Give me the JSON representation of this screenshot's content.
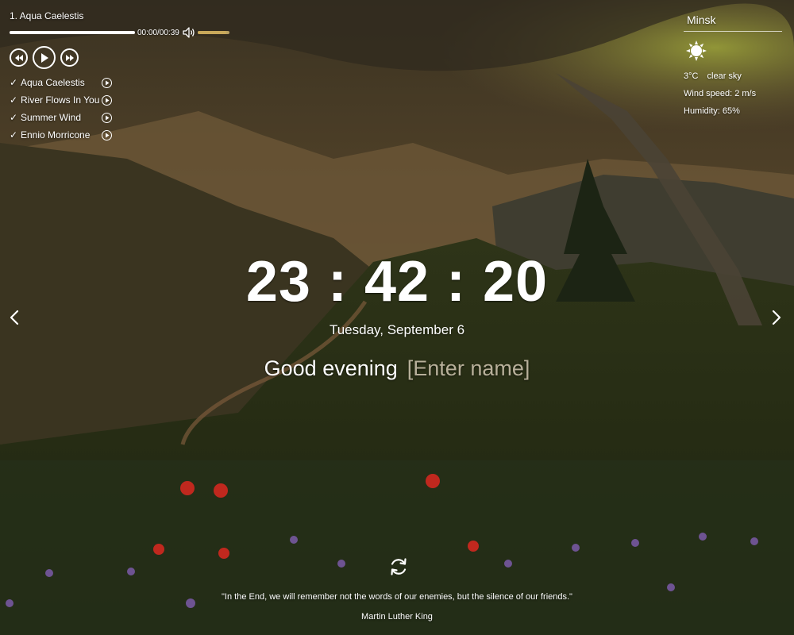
{
  "player": {
    "current_track": "1. Aqua Caelestis",
    "time": "00:00/00:39",
    "progress_fraction": 0,
    "volume_fraction": 0.9,
    "playlist": [
      {
        "label": "Aqua Caelestis",
        "check": "✓"
      },
      {
        "label": "River Flows In You",
        "check": "✓"
      },
      {
        "label": "Summer Wind",
        "check": "✓"
      },
      {
        "label": "Ennio Morricone",
        "check": "✓"
      }
    ],
    "icons": {
      "prev": "rewind-icon",
      "play": "play-icon",
      "next": "fast-forward-icon",
      "volume": "volume-icon"
    }
  },
  "weather": {
    "city": "Minsk",
    "icon": "clear-sky-sun-icon",
    "temperature": "3°C",
    "description": "clear sky",
    "wind": "Wind speed: 2 m/s",
    "humidity": "Humidity: 65%"
  },
  "clock": {
    "time": "23 : 42 : 20",
    "date": "Tuesday, September 6"
  },
  "greeting": {
    "text": "Good evening",
    "name_placeholder": "[Enter name]"
  },
  "quote": {
    "text": "\"In the End, we will remember not the words of our enemies, but the silence of our friends.\"",
    "author": "Martin Luther King"
  },
  "colors": {
    "text": "#ffffff",
    "placeholder": "#b8b09a",
    "volume": "#c8a85a"
  }
}
